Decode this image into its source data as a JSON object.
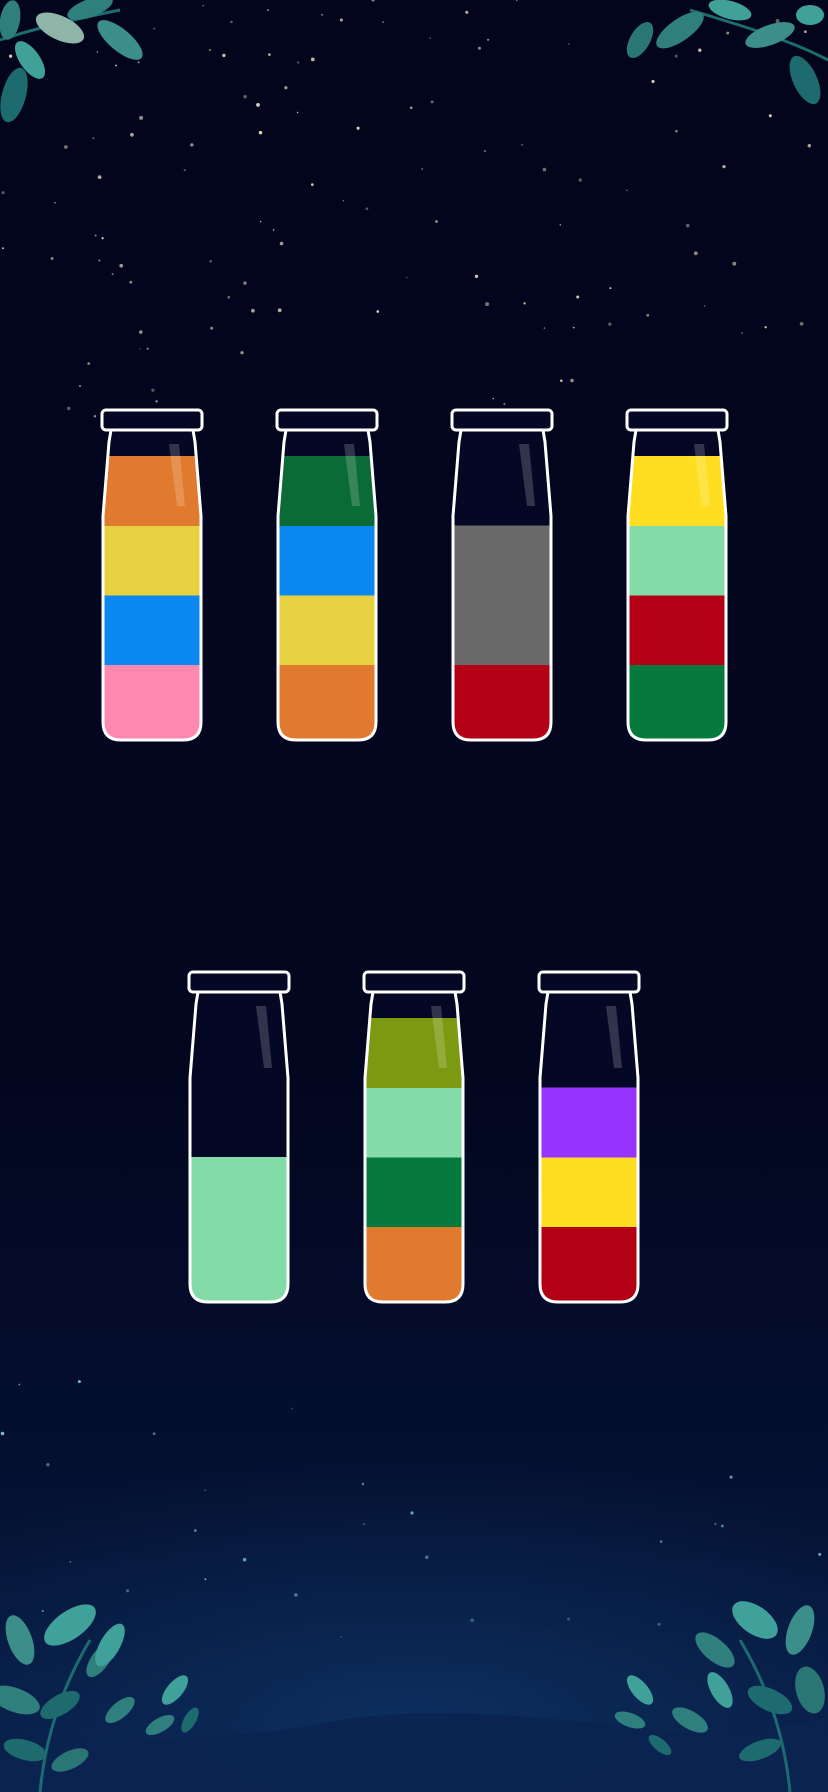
{
  "game": {
    "name": "water-sort-puzzle",
    "tube_capacity": 4,
    "palette": {
      "orange": "#e07a2e",
      "yellow": "#e8d140",
      "blue": "#0b87f0",
      "pink": "#ff88b0",
      "dark_green": "#0b6b36",
      "gray": "#6a6a6a",
      "red": "#b30014",
      "bright_yellow": "#ffde22",
      "mint": "#83dba7",
      "green": "#067a3c",
      "olive": "#7b9a12",
      "purple": "#9633ff"
    },
    "tubes": [
      {
        "id": "tube-1",
        "row": 1,
        "layers_top_to_bottom": [
          "orange",
          "yellow",
          "blue",
          "pink"
        ]
      },
      {
        "id": "tube-2",
        "row": 1,
        "layers_top_to_bottom": [
          "dark_green",
          "blue",
          "yellow",
          "orange"
        ]
      },
      {
        "id": "tube-3",
        "row": 1,
        "layers_top_to_bottom": [
          "gray",
          "gray",
          "red"
        ]
      },
      {
        "id": "tube-4",
        "row": 1,
        "layers_top_to_bottom": [
          "bright_yellow",
          "mint",
          "red",
          "green"
        ]
      },
      {
        "id": "tube-5",
        "row": 2,
        "layers_top_to_bottom": [
          "mint",
          "mint"
        ]
      },
      {
        "id": "tube-6",
        "row": 2,
        "layers_top_to_bottom": [
          "olive",
          "mint",
          "green",
          "orange"
        ]
      },
      {
        "id": "tube-7",
        "row": 2,
        "layers_top_to_bottom": [
          "purple",
          "bright_yellow",
          "red"
        ]
      }
    ],
    "decor": {
      "leaf_color_light": "#3fa19a",
      "leaf_color_dark": "#1e6b6f",
      "star_color": "#e9e2b8"
    }
  }
}
